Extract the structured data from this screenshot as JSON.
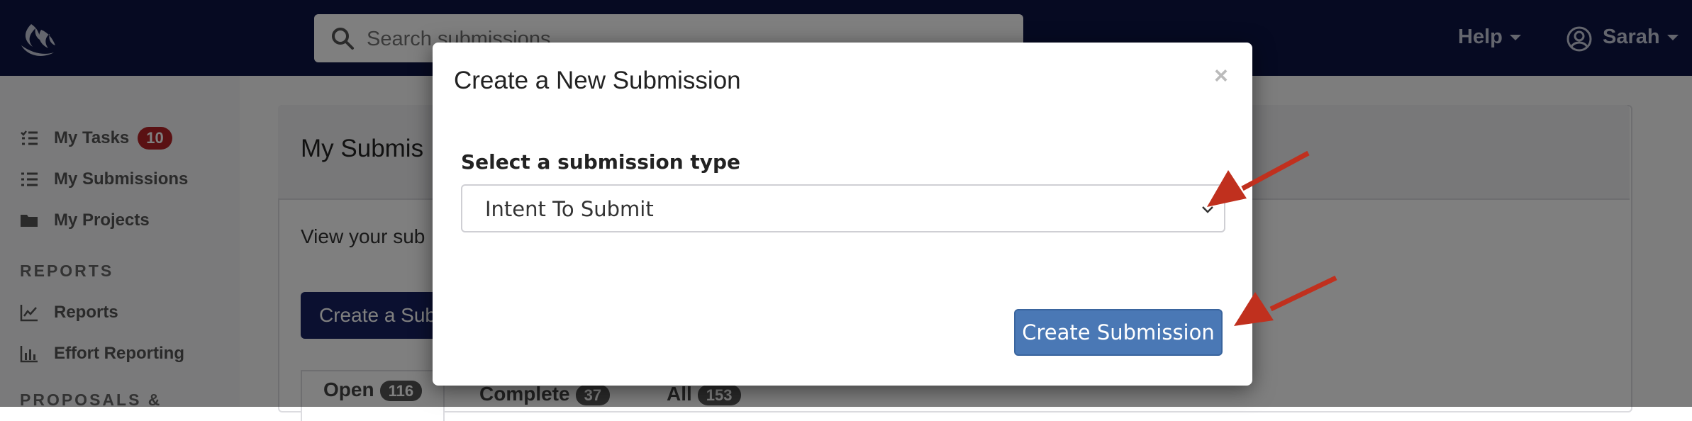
{
  "app": {
    "search_placeholder": "Search submissions",
    "help_label": "Help",
    "user_name": "Sarah"
  },
  "sidebar": {
    "items": [
      {
        "label": "My Tasks",
        "badge": "10",
        "icon": "tasks-icon"
      },
      {
        "label": "My Submissions",
        "icon": "list-icon"
      },
      {
        "label": "My Projects",
        "icon": "folder-icon"
      }
    ],
    "reports_section": "REPORTS",
    "reports_items": [
      {
        "label": "Reports",
        "icon": "chart-line-icon"
      },
      {
        "label": "Effort Reporting",
        "icon": "chart-bar-icon"
      }
    ],
    "proposals_section": "PROPOSALS &"
  },
  "main": {
    "card_title": "My Submis",
    "description": "View your sub",
    "create_button": "Create a Sub",
    "tabs": [
      {
        "label": "Open",
        "count": "116"
      },
      {
        "label": "Complete",
        "count": "37"
      },
      {
        "label": "All",
        "count": "153"
      }
    ]
  },
  "modal": {
    "title": "Create a New Submission",
    "close_symbol": "×",
    "select_label": "Select a submission type",
    "select_value": "Intent To Submit",
    "submit_button": "Create Submission"
  },
  "colors": {
    "topbar": "#0d1545",
    "primary_button": "#4a78b5",
    "badge": "#b52226",
    "arrow": "#c0301e"
  }
}
